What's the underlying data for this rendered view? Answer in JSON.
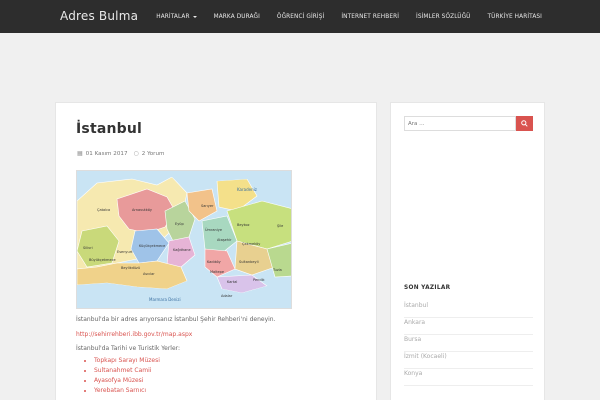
{
  "header": {
    "brand": "Adres Bulma",
    "nav": [
      "HARİTALAR",
      "MARKA DURAĞI",
      "ÖĞRENCİ GİRİŞİ",
      "İNTERNET REHBERİ",
      "İSİMLER SÖZLÜĞÜ",
      "TÜRKİYE HARİTASI"
    ]
  },
  "post": {
    "title": "İstanbul",
    "date": "01 Kasım 2017",
    "comments": "2 Yorum",
    "map_labels": [
      "Karadeniz",
      "Çatalca",
      "Arnavutköy",
      "Sarıyer",
      "Beykoz",
      "Eyüp",
      "Şile",
      "Silivri",
      "Çekmeköy",
      "Sultanbeyli",
      "Pendik",
      "Tuzla",
      "Büyükçekmece",
      "Esenyurt",
      "Beylikdüzü",
      "Avcılar",
      "Küçükçekmece",
      "Kadıköy",
      "Ataşehir",
      "Marmara Denizi",
      "Adalar",
      "Kartal",
      "Maltepe",
      "Kağıthane",
      "Ümraniye"
    ],
    "intro": "İstanbul'da bir adres arıyorsanız İstanbul Şehir Rehberi'ni deneyin.",
    "link": "http://sehirrehberi.ibb.gov.tr/map.aspx",
    "places_heading": "İstanbul'da Tarihi ve Turistik Yerler:",
    "places": [
      "Topkapı Sarayı Müzesi",
      "Sultanahmet Camii",
      "Ayasofya Müzesi",
      "Yerebatan Sarnıcı"
    ]
  },
  "sidebar": {
    "search_placeholder": "Ara …",
    "recent_title": "SON YAZILAR",
    "recent": [
      "İstanbul",
      "Ankara",
      "Bursa",
      "İzmit (Kocaeli)",
      "Konya"
    ]
  },
  "colors": {
    "accent": "#d9534f",
    "navbar": "#2d2d2d"
  }
}
